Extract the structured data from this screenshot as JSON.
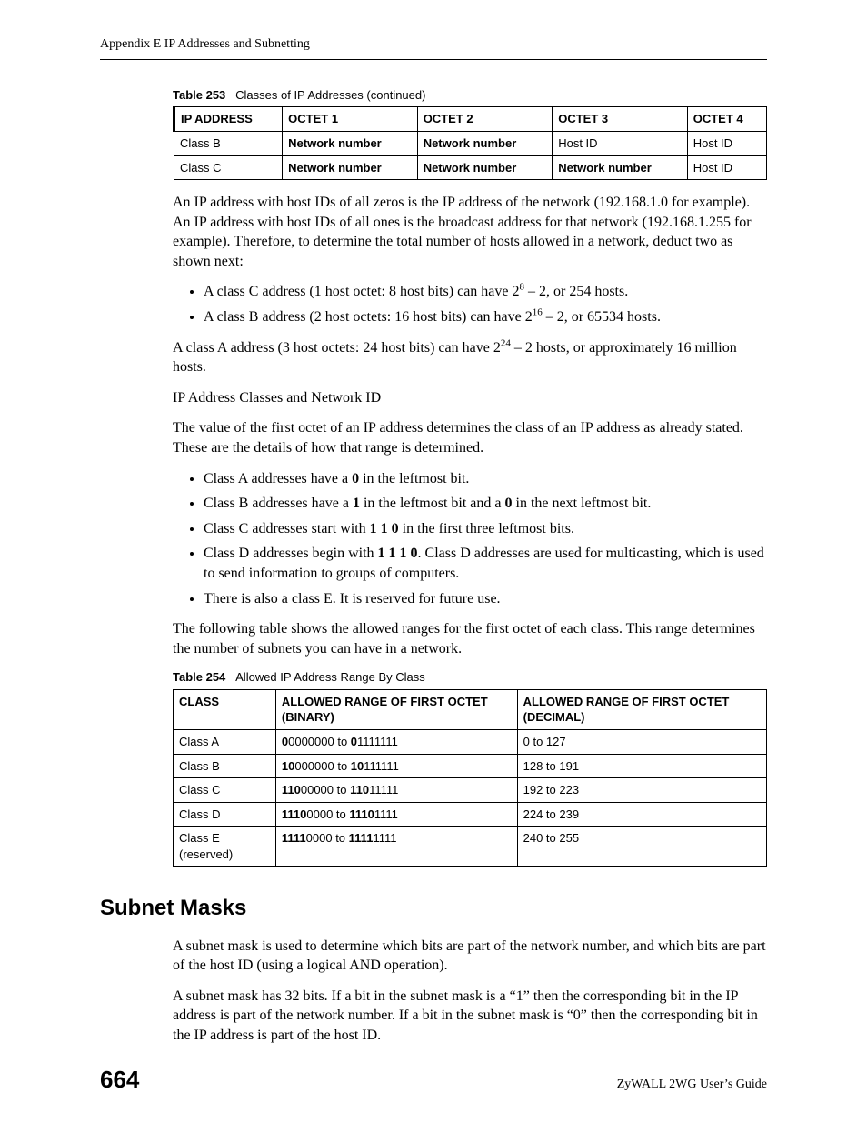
{
  "running_head": "Appendix E IP Addresses and Subnetting",
  "table253": {
    "caption_label": "Table 253",
    "caption_text": "Classes of IP Addresses (continued)",
    "headers": [
      "IP ADDRESS",
      "OCTET 1",
      "OCTET 2",
      "OCTET 3",
      "OCTET 4"
    ],
    "rows": [
      [
        "Class B",
        "Network number",
        "Network number",
        "Host ID",
        "Host ID"
      ],
      [
        "Class C",
        "Network number",
        "Network number",
        "Network number",
        "Host ID"
      ]
    ],
    "bold_map": [
      [
        false,
        true,
        true,
        false,
        false
      ],
      [
        false,
        true,
        true,
        true,
        false
      ]
    ]
  },
  "para1": "An IP address with host IDs of all zeros is the IP address of the network (192.168.1.0 for example). An IP address with host IDs of all ones is the broadcast address for that network (192.168.1.255 for example). Therefore, to determine the total number of hosts allowed in a network, deduct two as shown next:",
  "bullets1": {
    "b1_pre": "A class C address (1 host octet: 8 host bits) can have 2",
    "b1_sup": "8",
    "b1_post": " – 2, or 254 hosts.",
    "b2_pre": "A class B address (2 host octets: 16 host bits) can have 2",
    "b2_sup": "16",
    "b2_post": " – 2, or 65534 hosts."
  },
  "para2_pre": "A class A address (3 host octets: 24 host bits) can have 2",
  "para2_sup": "24",
  "para2_post": " – 2 hosts, or approximately 16 million hosts.",
  "para3": "IP Address Classes and Network ID",
  "para4": "The value of the first octet of an IP address determines the class of an IP address as already stated. These are the details of how that range is determined.",
  "bullets2": {
    "li1_pre": "Class A addresses have a ",
    "li1_bold": "0",
    "li1_post": " in the leftmost bit.",
    "li2_pre": "Class B addresses have a ",
    "li2_bold1": "1",
    "li2_mid": " in the leftmost bit and a ",
    "li2_bold2": "0",
    "li2_post": " in the next leftmost bit.",
    "li3_pre": "Class C addresses start with ",
    "li3_bold": "1 1 0",
    "li3_post": " in the first three leftmost bits.",
    "li4_pre": "Class D addresses begin with ",
    "li4_bold": "1 1 1 0",
    "li4_post": ". Class D addresses are used for multicasting, which is used to send information to groups of computers.",
    "li5": "There is also a class E. It is reserved for future use."
  },
  "para5": "The following table shows the allowed ranges for the first octet of each class. This range determines the number of subnets you can have in a network.",
  "table254": {
    "caption_label": "Table 254",
    "caption_text": "Allowed IP Address Range By Class",
    "headers": [
      "CLASS",
      "ALLOWED RANGE OF FIRST OCTET (BINARY)",
      "ALLOWED RANGE OF FIRST OCTET (DECIMAL)"
    ],
    "rows": [
      {
        "class": "Class A",
        "bin_bold1": "0",
        "bin_mid1": "0000000 to ",
        "bin_bold2": "0",
        "bin_mid2": "1111111",
        "dec": "0 to 127"
      },
      {
        "class": "Class B",
        "bin_bold1": "10",
        "bin_mid1": "000000 to ",
        "bin_bold2": "10",
        "bin_mid2": "111111",
        "dec": "128 to 191"
      },
      {
        "class": "Class C",
        "bin_bold1": "110",
        "bin_mid1": "00000 to ",
        "bin_bold2": "110",
        "bin_mid2": "11111",
        "dec": "192 to 223"
      },
      {
        "class": "Class D",
        "bin_bold1": "1110",
        "bin_mid1": "0000 to ",
        "bin_bold2": "1110",
        "bin_mid2": "1111",
        "dec": "224 to 239"
      },
      {
        "class": "Class E (reserved)",
        "bin_bold1": "1111",
        "bin_mid1": "0000 to ",
        "bin_bold2": "1111",
        "bin_mid2": "1111",
        "dec": "240 to 255"
      }
    ]
  },
  "section_heading": "Subnet Masks",
  "para6": "A subnet mask is used to determine which bits are part of the network number, and which bits are part of the host ID (using a logical AND operation).",
  "para7": "A subnet mask has 32 bits. If a bit in the subnet mask is a “1” then the corresponding bit in the IP address is part of the network number. If a bit in the subnet mask is “0” then the corresponding bit in the IP address is part of the host ID.",
  "footer": {
    "page": "664",
    "guide": "ZyWALL 2WG User’s Guide"
  }
}
